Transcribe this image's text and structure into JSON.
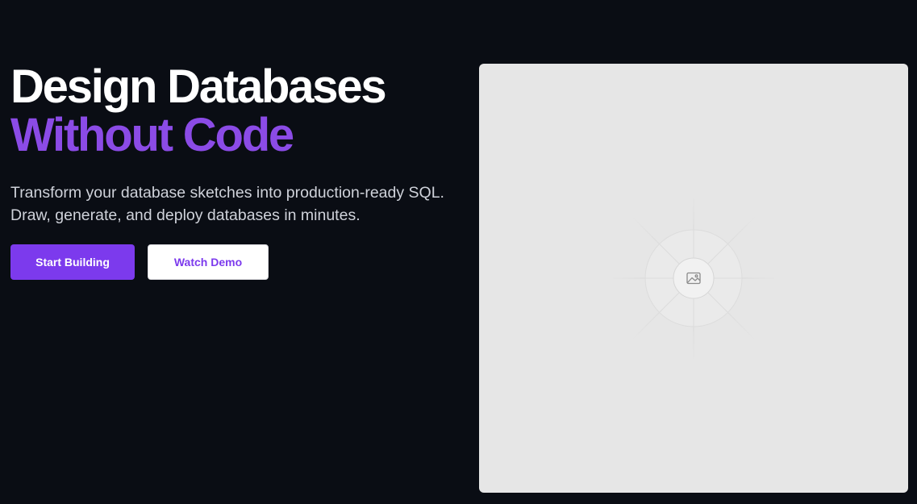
{
  "hero": {
    "headline_line1": "Design Databases",
    "headline_line2": "Without Code",
    "subtitle": "Transform your database sketches into production-ready SQL. Draw, generate, and deploy databases in minutes.",
    "primary_button": "Start Building",
    "secondary_button": "Watch Demo"
  },
  "media": {
    "icon": "image-icon"
  },
  "colors": {
    "background": "#0a0d14",
    "accent": "#7c3aed",
    "headline_accent": "#8b4be6",
    "placeholder_bg": "#e6e6e6"
  }
}
